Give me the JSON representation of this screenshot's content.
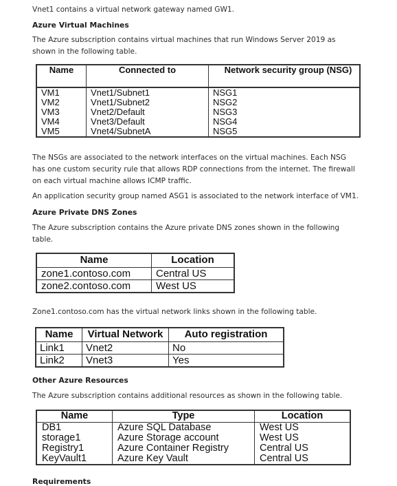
{
  "intro": "Vnet1 contains a virtual network gateway named GW1.",
  "vm_section": {
    "heading": "Azure Virtual Machines",
    "text": "The Azure subscription contains virtual machines that run Windows Server 2019 as shown in the following table.",
    "columns": [
      "Name",
      "Connected to",
      "Network security group (NSG)"
    ],
    "rows": [
      [
        "VM1",
        "Vnet1/Subnet1",
        "NSG1"
      ],
      [
        "VM2",
        "Vnet1/Subnet2",
        "NSG2"
      ],
      [
        "VM3",
        "Vnet2/Default",
        "NSG3"
      ],
      [
        "VM4",
        "Vnet3/Default",
        "NSG4"
      ],
      [
        "VM5",
        "Vnet4/SubnetA",
        "NSG5"
      ]
    ]
  },
  "nsg_text": "The NSGs are associated to the network interfaces on the virtual machines. Each NSG has one custom security rule that allows RDP connections from the internet. The firewall on each virtual machine allows ICMP traffic.",
  "asg_text": "An application security group named ASG1 is associated to the network interface of VM1.",
  "dns_section": {
    "heading": "Azure Private DNS Zones",
    "text": "The Azure subscription contains the Azure private DNS zones shown in the following table.",
    "columns": [
      "Name",
      "Location"
    ],
    "rows": [
      [
        "zone1.contoso.com",
        "Central US"
      ],
      [
        "zone2.contoso.com",
        "West US"
      ]
    ]
  },
  "links_section": {
    "text": "Zone1.contoso.com has the virtual network links shown in the following table.",
    "columns": [
      "Name",
      "Virtual Network",
      "Auto registration"
    ],
    "rows": [
      [
        "Link1",
        "Vnet2",
        "No"
      ],
      [
        "Link2",
        "Vnet3",
        "Yes"
      ]
    ]
  },
  "other_section": {
    "heading": "Other Azure Resources",
    "text": "The Azure subscription contains additional resources as shown in the following table.",
    "columns": [
      "Name",
      "Type",
      "Location"
    ],
    "rows": [
      [
        "DB1",
        "Azure SQL Database",
        "West US"
      ],
      [
        "storage1",
        "Azure Storage account",
        "West US"
      ],
      [
        "Registry1",
        "Azure Container Registry",
        "Central US"
      ],
      [
        "KeyVault1",
        "Azure Key Vault",
        "Central US"
      ]
    ]
  },
  "next_heading": "Requirements"
}
